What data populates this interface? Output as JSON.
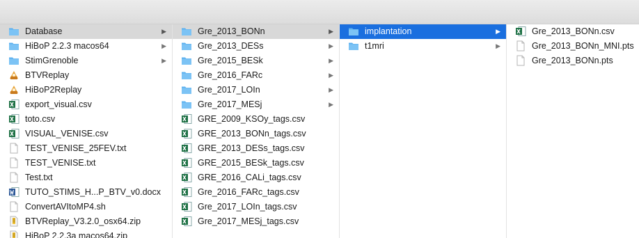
{
  "columns": [
    {
      "items": [
        {
          "label": "Database",
          "type": "folder",
          "state": "active",
          "chevron": true
        },
        {
          "label": "HiBoP 2.2.3 macos64",
          "type": "folder",
          "chevron": true
        },
        {
          "label": "StimGrenoble",
          "type": "folder",
          "chevron": true
        },
        {
          "label": "BTVReplay",
          "type": "app"
        },
        {
          "label": "HiBoP2Replay",
          "type": "app"
        },
        {
          "label": "export_visual.csv",
          "type": "excel"
        },
        {
          "label": "toto.csv",
          "type": "excel"
        },
        {
          "label": "VISUAL_VENISE.csv",
          "type": "excel"
        },
        {
          "label": "TEST_VENISE_25FEV.txt",
          "type": "text"
        },
        {
          "label": "TEST_VENISE.txt",
          "type": "text"
        },
        {
          "label": "Test.txt",
          "type": "text"
        },
        {
          "label": "TUTO_STIMS_H...P_BTV_v0.docx",
          "type": "word"
        },
        {
          "label": "ConvertAVItoMP4.sh",
          "type": "text"
        },
        {
          "label": "BTVReplay_V3.2.0_osx64.zip",
          "type": "zip"
        },
        {
          "label": "HiBoP 2.2.3a macos64.zip",
          "type": "zip"
        }
      ]
    },
    {
      "items": [
        {
          "label": "Gre_2013_BONn",
          "type": "folder",
          "state": "active",
          "chevron": true
        },
        {
          "label": "Gre_2013_DESs",
          "type": "folder",
          "chevron": true
        },
        {
          "label": "Gre_2015_BESk",
          "type": "folder",
          "chevron": true
        },
        {
          "label": "Gre_2016_FARc",
          "type": "folder",
          "chevron": true
        },
        {
          "label": "Gre_2017_LOIn",
          "type": "folder",
          "chevron": true
        },
        {
          "label": "Gre_2017_MESj",
          "type": "folder",
          "chevron": true
        },
        {
          "label": "GRE_2009_KSOy_tags.csv",
          "type": "excel"
        },
        {
          "label": "GRE_2013_BONn_tags.csv",
          "type": "excel"
        },
        {
          "label": "GRE_2013_DESs_tags.csv",
          "type": "excel"
        },
        {
          "label": "GRE_2015_BESk_tags.csv",
          "type": "excel"
        },
        {
          "label": "GRE_2016_CALi_tags.csv",
          "type": "excel"
        },
        {
          "label": "Gre_2016_FARc_tags.csv",
          "type": "excel"
        },
        {
          "label": "Gre_2017_LOIn_tags.csv",
          "type": "excel"
        },
        {
          "label": "Gre_2017_MESj_tags.csv",
          "type": "excel"
        }
      ]
    },
    {
      "items": [
        {
          "label": "implantation",
          "type": "folder",
          "state": "selected",
          "chevron": true
        },
        {
          "label": "t1mri",
          "type": "folder",
          "chevron": true
        }
      ]
    },
    {
      "items": [
        {
          "label": "Gre_2013_BONn.csv",
          "type": "excel"
        },
        {
          "label": "Gre_2013_BONn_MNI.pts",
          "type": "text"
        },
        {
          "label": "Gre_2013_BONn.pts",
          "type": "text"
        }
      ]
    }
  ],
  "chevron_glyph": "▶",
  "colors": {
    "selection": "#1a6fdf",
    "path_highlight": "#d8d8d8",
    "folder": "#5bb0ef",
    "excel": "#1e7145"
  }
}
